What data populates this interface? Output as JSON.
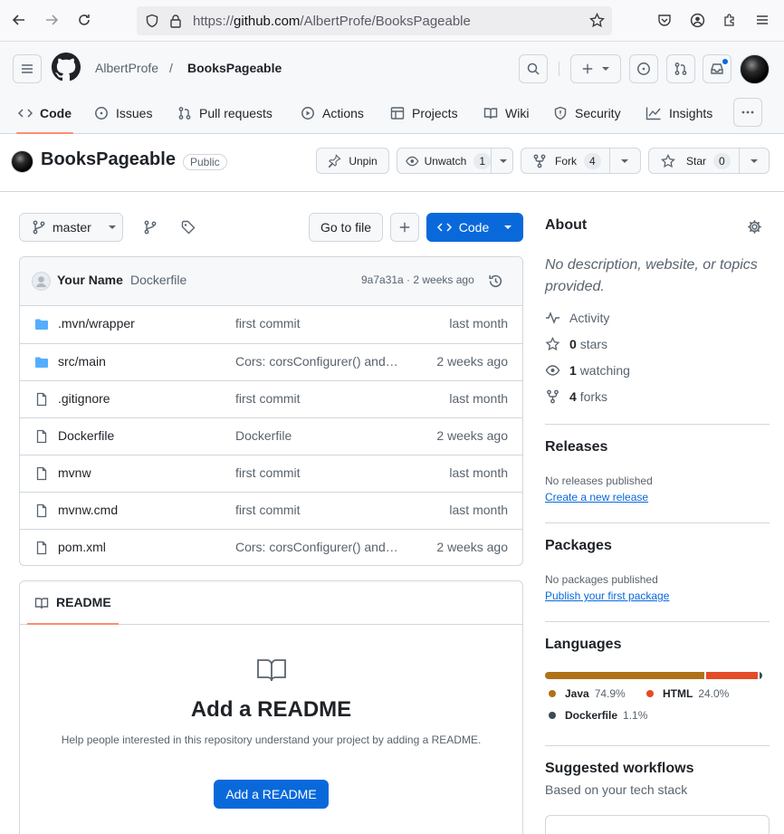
{
  "browser": {
    "url_scheme": "https://",
    "url_host": "github.com",
    "url_path": "/AlbertProfe/BooksPageable"
  },
  "header": {
    "owner": "AlbertProfe",
    "separator": "/",
    "repo": "BooksPageable"
  },
  "tabs": [
    {
      "label": "Code",
      "icon": "code-icon",
      "active": true
    },
    {
      "label": "Issues",
      "icon": "issue-opened-icon"
    },
    {
      "label": "Pull requests",
      "icon": "git-pull-request-icon"
    },
    {
      "label": "Actions",
      "icon": "play-icon"
    },
    {
      "label": "Projects",
      "icon": "table-icon"
    },
    {
      "label": "Wiki",
      "icon": "book-icon"
    },
    {
      "label": "Security",
      "icon": "shield-icon"
    },
    {
      "label": "Insights",
      "icon": "graph-icon"
    }
  ],
  "repo": {
    "name": "BooksPageable",
    "visibility": "Public",
    "unpin_label": "Unpin",
    "unwatch_label": "Unwatch",
    "watch_count": "1",
    "fork_label": "Fork",
    "fork_count": "4",
    "star_label": "Star",
    "star_count": "0"
  },
  "toolbar": {
    "branch": "master",
    "go_to_file": "Go to file",
    "code_label": "Code"
  },
  "commit": {
    "author": "Your Name",
    "message": "Dockerfile",
    "hash_age": "9a7a31a · 2 weeks ago"
  },
  "files": [
    {
      "name": ".mvn/wrapper",
      "type": "folder",
      "message": "first commit",
      "age": "last month"
    },
    {
      "name": "src/main",
      "type": "folder",
      "message": "Cors: corsConfigurer() and…",
      "age": "2 weeks ago"
    },
    {
      "name": ".gitignore",
      "type": "file",
      "message": "first commit",
      "age": "last month"
    },
    {
      "name": "Dockerfile",
      "type": "file",
      "message": "Dockerfile",
      "age": "2 weeks ago"
    },
    {
      "name": "mvnw",
      "type": "file",
      "message": "first commit",
      "age": "last month"
    },
    {
      "name": "mvnw.cmd",
      "type": "file",
      "message": "first commit",
      "age": "last month"
    },
    {
      "name": "pom.xml",
      "type": "file",
      "message": "Cors: corsConfigurer() and…",
      "age": "2 weeks ago"
    }
  ],
  "readme": {
    "tab_label": "README",
    "title": "Add a README",
    "description": "Help people interested in this repository understand your project by adding a README.",
    "button": "Add a README"
  },
  "about": {
    "title": "About",
    "description": "No description, website, or topics provided.",
    "activity": "Activity",
    "stars_count": "0",
    "stars_label": "stars",
    "watching_count": "1",
    "watching_label": "watching",
    "forks_count": "4",
    "forks_label": "forks"
  },
  "releases": {
    "title": "Releases",
    "empty": "No releases published",
    "link": "Create a new release"
  },
  "packages": {
    "title": "Packages",
    "empty": "No packages published",
    "link": "Publish your first package"
  },
  "languages": {
    "title": "Languages",
    "items": [
      {
        "name": "Java",
        "percent": "74.9%",
        "color": "#b07219"
      },
      {
        "name": "HTML",
        "percent": "24.0%",
        "color": "#e34c26"
      },
      {
        "name": "Dockerfile",
        "percent": "1.1%",
        "color": "#384d54"
      }
    ]
  },
  "workflows": {
    "title": "Suggested workflows",
    "subtitle": "Based on your tech stack"
  },
  "colors": {
    "accent": "#0969da",
    "tab_underline": "#fd8c73",
    "folder": "#54aeff"
  }
}
